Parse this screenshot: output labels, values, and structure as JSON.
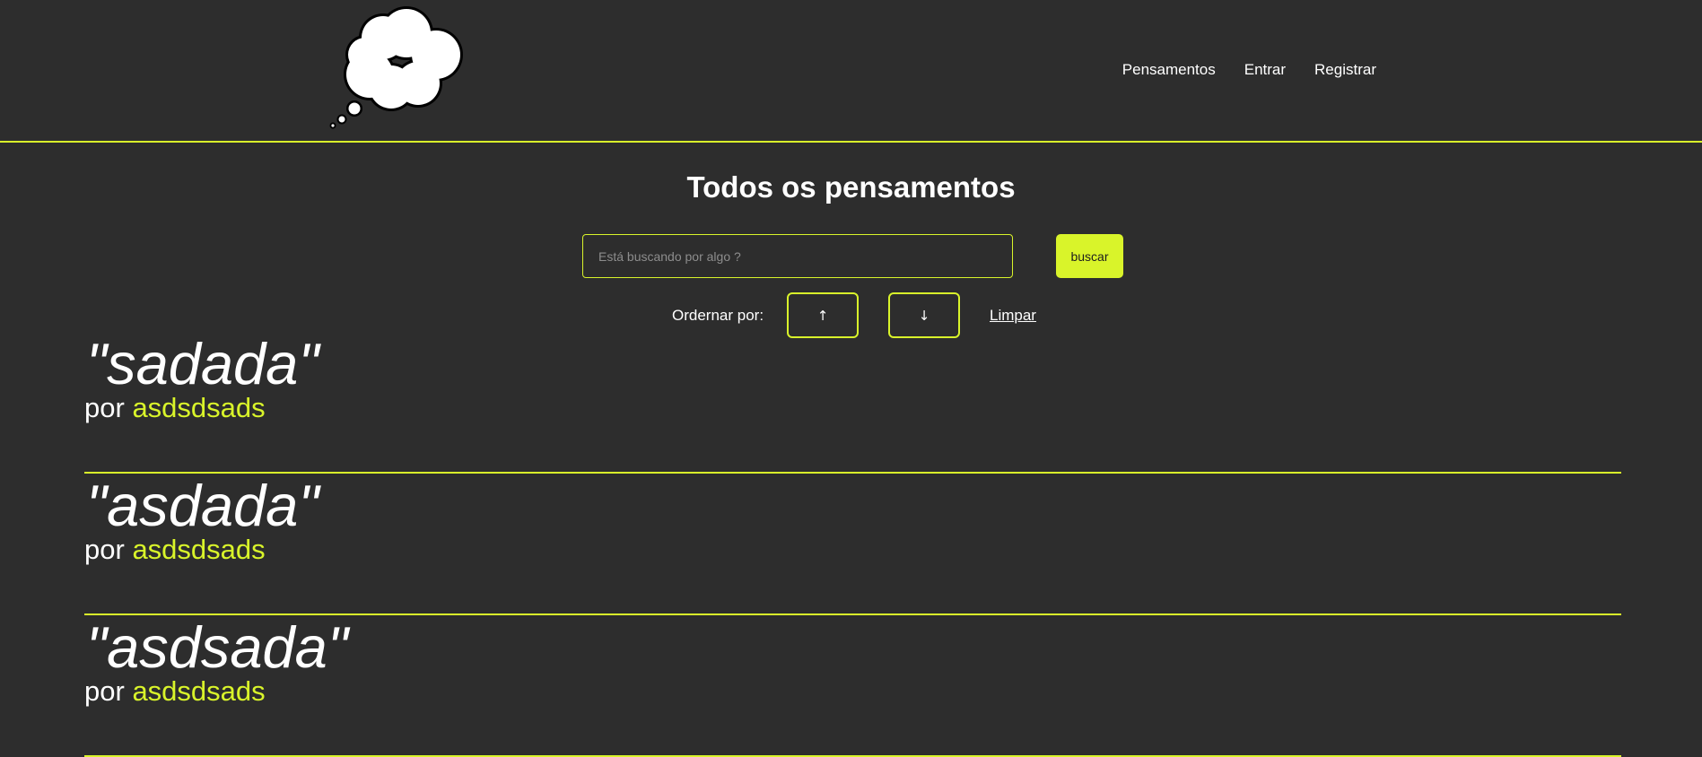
{
  "nav": {
    "items": [
      "Pensamentos",
      "Entrar",
      "Registrar"
    ]
  },
  "page": {
    "title": "Todos os pensamentos"
  },
  "search": {
    "placeholder": "Está buscando por algo ?",
    "value": "",
    "button_label": "buscar"
  },
  "order": {
    "label": "Ordernar por:",
    "asc_symbol": "↑",
    "desc_symbol": "↓",
    "clear_label": "Limpar"
  },
  "thoughts": [
    {
      "quote": "\"sadada\"",
      "by_label": "por",
      "author": "asdsdsads"
    },
    {
      "quote": "\"asdada\"",
      "by_label": "por",
      "author": "asdsdsads"
    },
    {
      "quote": "\"asdsada\"",
      "by_label": "por",
      "author": "asdsdsads"
    }
  ],
  "colors": {
    "background": "#2d2d2d",
    "accent": "#d9f42a",
    "text": "#ffffff"
  },
  "icons": {
    "logo": "thought-cloud-icon",
    "order_asc": "arrow-up-icon",
    "order_desc": "arrow-down-icon"
  }
}
